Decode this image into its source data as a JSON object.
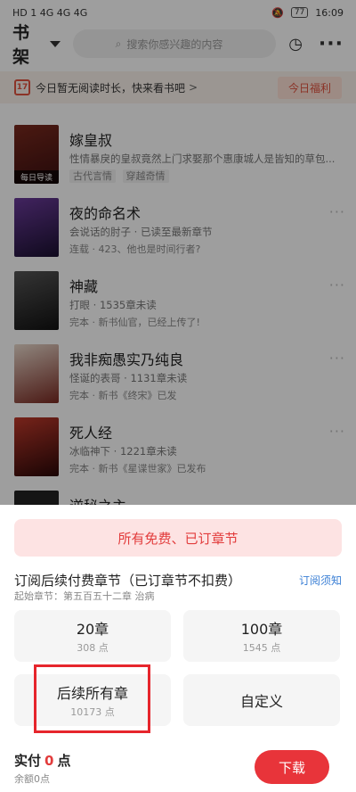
{
  "status": {
    "left": "HD 1 4G 4G 4G",
    "battery": "77",
    "time": "16:09"
  },
  "header": {
    "title": "书架",
    "search_placeholder": "搜索你感兴趣的内容"
  },
  "promo": {
    "date": "17",
    "text": "今日暂无阅读时长，快来看书吧",
    "chevron": ">",
    "benefit": "今日福利"
  },
  "books": [
    {
      "title": "嫁皇叔",
      "desc": "性情暴戾的皇叔竟然上门求娶那个惠康城人是皆知的草包...",
      "meta": "",
      "genres": [
        "古代言情",
        "穿越奇情"
      ],
      "cover_tag": "每日导读",
      "cover_color": "#5a1c1c"
    },
    {
      "title": "夜的命名术",
      "desc": "会说话的肘子 · 已读至最新章节",
      "meta": "连载 · 423、他也是时间行者?",
      "cover_color": "#2a1a45"
    },
    {
      "title": "神藏",
      "desc": "打眼 · 1535章未读",
      "meta": "完本 · 新书仙官，已经上传了!",
      "cover_color": "#2b2b2b"
    },
    {
      "title": "我非痴愚实乃纯良",
      "desc": "怪诞的表哥 · 1131章未读",
      "meta": "完本 · 新书《终宋》已发",
      "cover_color": "#6b2a22"
    },
    {
      "title": "死人经",
      "desc": "冰临神下 · 1221章未读",
      "meta": "完本 · 新书《星谍世家》已发布",
      "cover_color": "#3a1010"
    },
    {
      "title": "逆秘之主",
      "desc": "",
      "meta": "",
      "cover_color": "#222"
    }
  ],
  "sheet": {
    "free_label": "所有免费、已订章节",
    "subscribe_title": "订阅后续付费章节（已订章节不扣费）",
    "subscribe_note": "订阅须知",
    "start_chapter": "起始章节：第五百五十二章 治病",
    "options": [
      {
        "name": "20章",
        "points": "308 点"
      },
      {
        "name": "100章",
        "points": "1545 点"
      },
      {
        "name": "后续所有章",
        "points": "10173 点"
      },
      {
        "name": "自定义",
        "points": ""
      }
    ],
    "pay_prefix": "实付",
    "pay_amount": "0",
    "pay_unit": "点",
    "balance": "余额0点",
    "download": "下载"
  },
  "colors": {
    "accent": "#e8343a",
    "highlight_box": "#e6252c"
  }
}
